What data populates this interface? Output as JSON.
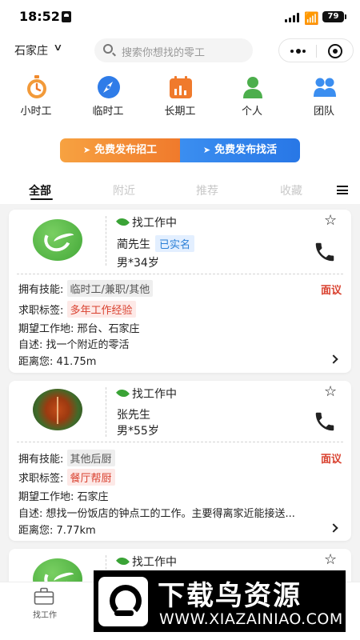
{
  "status_bar": {
    "time": "18:52",
    "battery": "79"
  },
  "header": {
    "city": "石家庄",
    "search_placeholder": "搜索你想找的零工"
  },
  "categories": [
    {
      "label": "小时工",
      "icon": "stopwatch-icon",
      "color": "#f08a2c"
    },
    {
      "label": "临时工",
      "icon": "compass-icon",
      "color": "#2f7ce8"
    },
    {
      "label": "长期工",
      "icon": "calendar-chart-icon",
      "color": "#f07a2c"
    },
    {
      "label": "个人",
      "icon": "person-icon",
      "color": "#4cae4c"
    },
    {
      "label": "团队",
      "icon": "team-icon",
      "color": "#3b8ef0"
    }
  ],
  "publish": {
    "recruit_label": "免费发布招工",
    "find_label": "免费发布找活"
  },
  "tabs": [
    {
      "label": "全部",
      "active": true
    },
    {
      "label": "附近",
      "active": false
    },
    {
      "label": "推荐",
      "active": false
    },
    {
      "label": "收藏",
      "active": false
    }
  ],
  "cards": [
    {
      "status": "找工作中",
      "name": "蔺先生",
      "badge": "已实名",
      "gender_age": "男*34岁",
      "skills_label": "拥有技能:",
      "skills": "临时工/兼职/其他",
      "salary": "面议",
      "tags_label": "求职标签:",
      "tag": "多年工作经验",
      "location_label": "期望工作地:",
      "location": "邢台、石家庄",
      "intro_label": "自述:",
      "intro": "找一个附近的零活",
      "distance_label": "距离您:",
      "distance": "41.75m"
    },
    {
      "status": "找工作中",
      "name": "张先生",
      "gender_age": "男*55岁",
      "skills_label": "拥有技能:",
      "skills": "其他后厨",
      "salary": "面议",
      "tags_label": "求职标签:",
      "tag": "餐厅帮厨",
      "location_label": "期望工作地:",
      "location": "石家庄",
      "intro_label": "自述:",
      "intro": "想找一份饭店的钟点工的工作。主要得离家近能接送...",
      "distance_label": "距离您:",
      "distance": "7.77km"
    },
    {
      "status": "找工作中"
    }
  ],
  "bottom_nav": {
    "find_work_label": "找工作"
  },
  "watermark": {
    "title": "下载鸟资源",
    "url": "WWW.XIAZAINIAO.COM"
  },
  "colors": {
    "accent_green": "#3aa336",
    "accent_red": "#d9412f",
    "accent_blue": "#2b7fd6",
    "orange": "#f07a2c"
  }
}
